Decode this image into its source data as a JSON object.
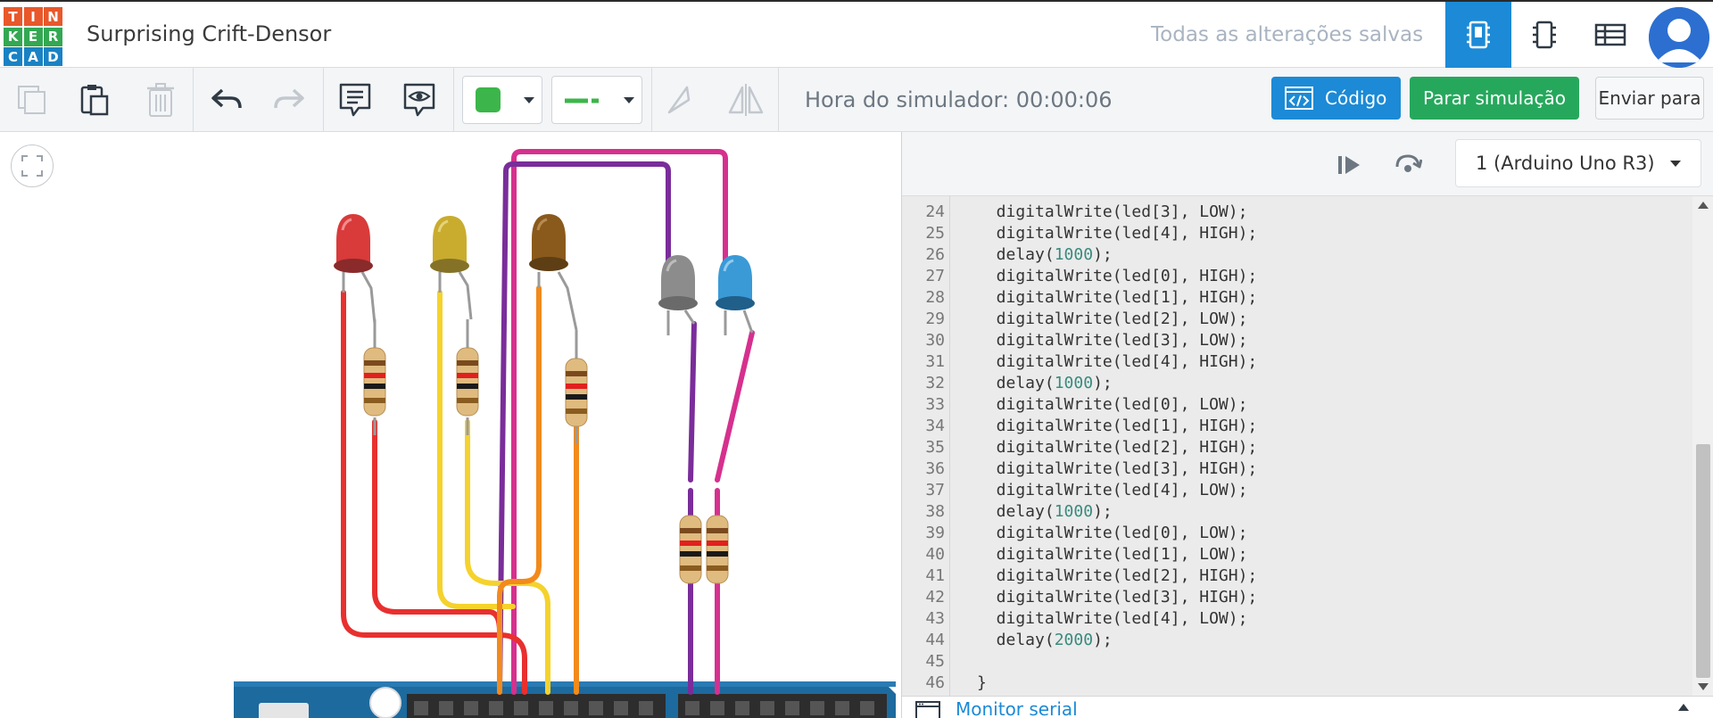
{
  "app": {
    "logo_letters": [
      "T",
      "I",
      "N",
      "K",
      "E",
      "R",
      "C",
      "A",
      "D"
    ],
    "logo_colors": [
      "#e8582b",
      "#e8582b",
      "#e8582b",
      "#33a852",
      "#33a852",
      "#33a852",
      "#1a82c4",
      "#1a82c4",
      "#1a82c4"
    ],
    "project_title": "Surprising Crift-Densor",
    "save_status": "Todas as alterações salvas"
  },
  "header": {
    "views": [
      {
        "icon": "circuit-view-icon",
        "active": true
      },
      {
        "icon": "schematic-view-icon",
        "active": false
      },
      {
        "icon": "component-list-icon",
        "active": false
      }
    ],
    "avatar_icon": "user-avatar-icon"
  },
  "toolbar": {
    "tools": [
      "copy-icon",
      "paste-icon",
      "delete-icon",
      "undo-icon",
      "redo-icon",
      "note-icon",
      "toggle-notes-icon"
    ],
    "color_swatch": "#3cb64a",
    "wire_color": "#3cb64a",
    "sim_time_label": "Hora do simulador: 00:00:06",
    "code_label": "Código",
    "stop_sim_label": "Parar simulação",
    "send_to_label": "Enviar para"
  },
  "code_panel": {
    "board_label": "1 (Arduino Uno R3)",
    "serial_monitor_label": "Monitor serial",
    "lines": [
      {
        "n": "24",
        "code": "  digitalWrite(led[3], LOW);"
      },
      {
        "n": "25",
        "code": "  digitalWrite(led[4], HIGH);"
      },
      {
        "n": "26",
        "code": "  delay(1000);"
      },
      {
        "n": "27",
        "code": "  digitalWrite(led[0], HIGH);"
      },
      {
        "n": "28",
        "code": "  digitalWrite(led[1], HIGH);"
      },
      {
        "n": "29",
        "code": "  digitalWrite(led[2], LOW);"
      },
      {
        "n": "30",
        "code": "  digitalWrite(led[3], LOW);"
      },
      {
        "n": "31",
        "code": "  digitalWrite(led[4], HIGH);"
      },
      {
        "n": "32",
        "code": "  delay(1000);"
      },
      {
        "n": "33",
        "code": "  digitalWrite(led[0], LOW);"
      },
      {
        "n": "34",
        "code": "  digitalWrite(led[1], HIGH);"
      },
      {
        "n": "35",
        "code": "  digitalWrite(led[2], HIGH);"
      },
      {
        "n": "36",
        "code": "  digitalWrite(led[3], HIGH);"
      },
      {
        "n": "37",
        "code": "  digitalWrite(led[4], LOW);"
      },
      {
        "n": "38",
        "code": "  delay(1000);"
      },
      {
        "n": "39",
        "code": "  digitalWrite(led[0], LOW);"
      },
      {
        "n": "40",
        "code": "  digitalWrite(led[1], LOW);"
      },
      {
        "n": "41",
        "code": "  digitalWrite(led[2], HIGH);"
      },
      {
        "n": "42",
        "code": "  digitalWrite(led[3], HIGH);"
      },
      {
        "n": "43",
        "code": "  digitalWrite(led[4], LOW);"
      },
      {
        "n": "44",
        "code": "  delay(2000);"
      },
      {
        "n": "45",
        "code": ""
      },
      {
        "n": "46",
        "code": "}"
      }
    ]
  },
  "circuit": {
    "leds": [
      {
        "color": "#d93a3a",
        "state": "on"
      },
      {
        "color": "#c9ac2e",
        "state": "dim"
      },
      {
        "color": "#8a5a1c",
        "state": "dim"
      },
      {
        "color": "#8c8c8c",
        "state": "off"
      },
      {
        "color": "#3a9ad6",
        "state": "on"
      }
    ],
    "wire_colors": [
      "#e8302f",
      "#f5d22c",
      "#f28a1c",
      "#7a2d9a",
      "#d6308e"
    ]
  }
}
